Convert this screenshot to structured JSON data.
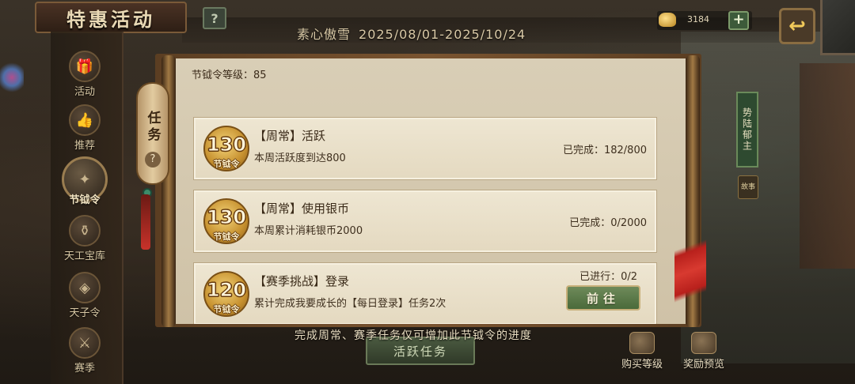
{
  "header": {
    "title": "特惠活动",
    "help": "?",
    "event_name": "素心傲雪",
    "event_dates": "2025/08/01-2025/10/24",
    "currency_amount": "3184",
    "currency_plus": "+",
    "back": "↩"
  },
  "sidebar": {
    "items": [
      {
        "label": "活动",
        "icon": "gift-icon"
      },
      {
        "label": "推荐",
        "icon": "thumbs-up-icon"
      },
      {
        "label": "节钺令",
        "icon": "token-icon"
      },
      {
        "label": "天工宝库",
        "icon": "treasure-icon"
      },
      {
        "label": "天子令",
        "icon": "decree-icon"
      },
      {
        "label": "赛季",
        "icon": "season-icon"
      }
    ]
  },
  "panel": {
    "tab_label": "任务",
    "tab_help": "?",
    "level_label": "节钺令等级：85",
    "tasks": [
      {
        "points": "130",
        "unit": "节钺令",
        "title": "【周常】活跃",
        "desc": "本周活跃度到达800",
        "progress": "已完成：182/800"
      },
      {
        "points": "130",
        "unit": "节钺令",
        "title": "【周常】使用银币",
        "desc": "本周累计消耗银币2000",
        "progress": "已完成：0/2000"
      },
      {
        "points": "120",
        "unit": "节钺令",
        "title": "【赛季挑战】登录",
        "desc": "累计完成我要成长的【每日登录】任务2次",
        "progress": "已进行：0/2",
        "button": "前往"
      }
    ]
  },
  "footer": {
    "note": "完成周常、赛季任务仅可增加此节钺令的进度",
    "active_tasks_button": "活跃任务",
    "buy_level": "购买等级",
    "reward_preview": "奖励预览"
  },
  "right_side": {
    "sign_text": "势陆郁主",
    "story": "故事"
  },
  "colors": {
    "accent_gold": "#c7912f",
    "go_button_green": "#4a6a3a",
    "panel_parchment": "#d9ceb6"
  }
}
